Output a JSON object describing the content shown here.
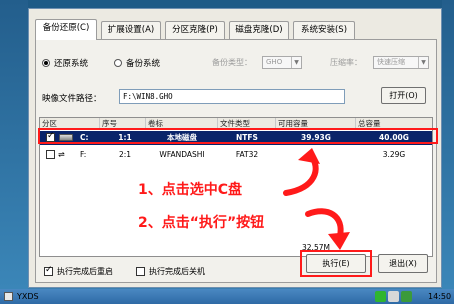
{
  "tabs": [
    {
      "label": "备份还原(C)",
      "active": true
    },
    {
      "label": "扩展设置(A)",
      "active": false
    },
    {
      "label": "分区克隆(P)",
      "active": false
    },
    {
      "label": "磁盘克隆(D)",
      "active": false
    },
    {
      "label": "系统安装(S)",
      "active": false
    }
  ],
  "mode": {
    "restore_label": "还原系统",
    "backup_label": "备份系统",
    "selected": "restore",
    "backup_type_label": "备份类型：",
    "backup_type_value": "GHO",
    "compress_label": "压缩率：",
    "compress_value": "快速压缩"
  },
  "image_path": {
    "label": "映像文件路径：",
    "value": "F:\\WIN8.GHO",
    "open_button": "打开(O)"
  },
  "table": {
    "headers": [
      "分区",
      "序号",
      "卷标",
      "文件类型",
      "可用容量",
      "总容量"
    ],
    "rows": [
      {
        "checked": true,
        "drive": "C:",
        "index": "1:1",
        "label": "本地磁盘",
        "fs": "NTFS",
        "free": "39.93G",
        "total": "40.00G",
        "selected": true
      },
      {
        "checked": false,
        "drive": "F:",
        "index": "2:1",
        "label": "WFANDASHI",
        "fs": "FAT32",
        "free": "",
        "total": "3.29G",
        "selected": false
      }
    ],
    "partial_free_value": "32.57M"
  },
  "annotations": {
    "step1": "1、点击选中C盘",
    "step2": "2、点击“执行”按钮"
  },
  "options": {
    "reboot_label": "执行完成后重启",
    "reboot_checked": true,
    "shutdown_label": "执行完成后关机",
    "shutdown_checked": false
  },
  "buttons": {
    "execute": "执行(E)",
    "exit": "退出(X)"
  },
  "taskbar": {
    "app_label": "YXDS",
    "time": "14:50"
  },
  "colors": {
    "selection": "#0a246a",
    "annotation": "#ff1a1a"
  }
}
